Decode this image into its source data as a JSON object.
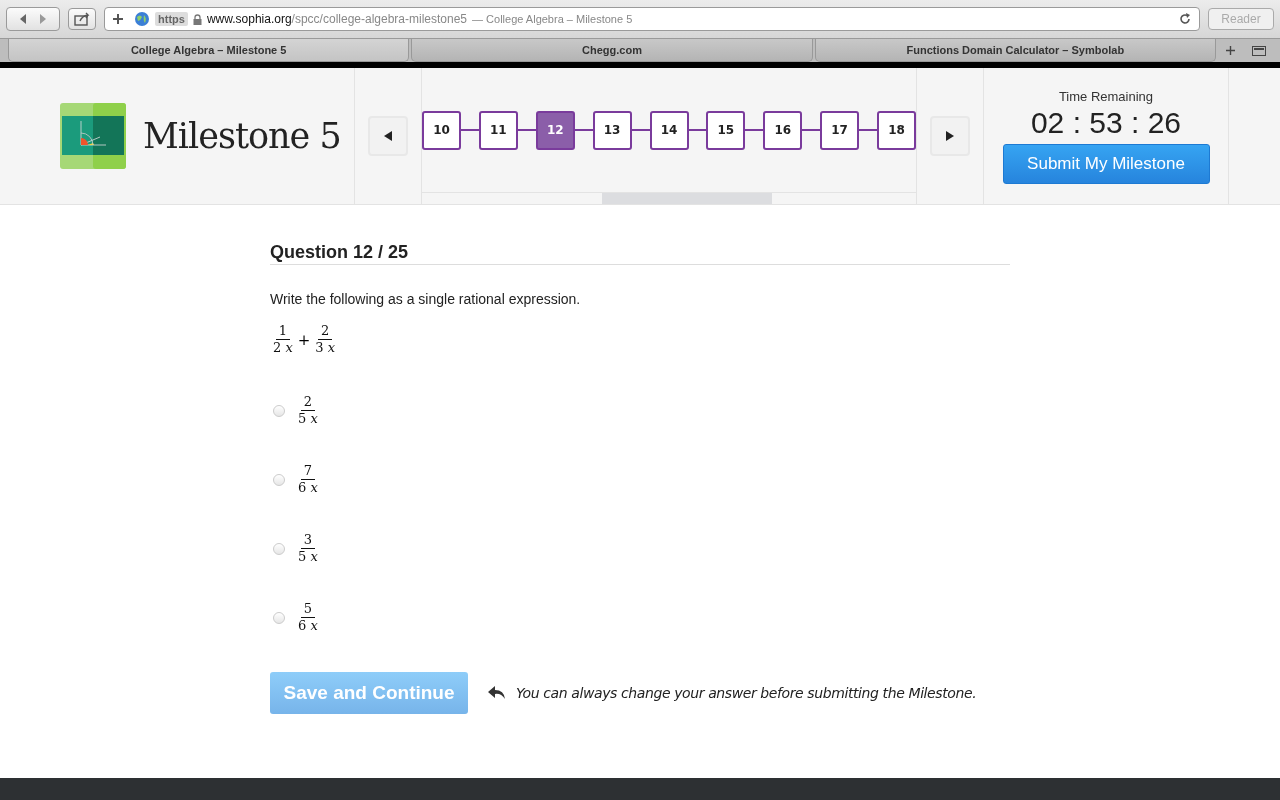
{
  "browser": {
    "address": {
      "scheme": "https",
      "domain": "www.sophia.org",
      "path": "/spcc/college-algebra-milestone5",
      "title": "— College Algebra – Milestone 5"
    },
    "reader": "Reader",
    "tabs": [
      {
        "label": "College Algebra – Milestone 5",
        "selected": true
      },
      {
        "label": "Chegg.com",
        "selected": false
      },
      {
        "label": "Functions Domain Calculator – Symbolab",
        "selected": false
      }
    ]
  },
  "header": {
    "title": "Milestone 5",
    "questions": [
      {
        "label": "10",
        "selected": false
      },
      {
        "label": "11",
        "selected": false
      },
      {
        "label": "12",
        "selected": true
      },
      {
        "label": "13",
        "selected": false
      },
      {
        "label": "14",
        "selected": false
      },
      {
        "label": "15",
        "selected": false
      },
      {
        "label": "16",
        "selected": false
      },
      {
        "label": "17",
        "selected": false
      },
      {
        "label": "18",
        "selected": false
      }
    ],
    "timer_label": "Time Remaining",
    "timer": "02 : 53 : 26",
    "submit": "Submit My Milestone"
  },
  "question": {
    "heading": "Question 12 / 25",
    "prompt": "Write the following as a single rational expression.",
    "expression": {
      "operator": "+",
      "terms": [
        {
          "numerator": "1",
          "denominator": "2 *x*"
        },
        {
          "numerator": "2",
          "denominator": "3 *x*"
        }
      ]
    },
    "options": [
      {
        "numerator": "2",
        "denominator": "5 *x*",
        "selected": false
      },
      {
        "numerator": "7",
        "denominator": "6 *x*",
        "selected": false
      },
      {
        "numerator": "3",
        "denominator": "5 *x*",
        "selected": false
      },
      {
        "numerator": "5",
        "denominator": "6 *x*",
        "selected": false
      }
    ]
  },
  "save": {
    "label": "Save and Continue",
    "disabled": true
  },
  "hint": "You can always change your answer before submitting the Milestone."
}
